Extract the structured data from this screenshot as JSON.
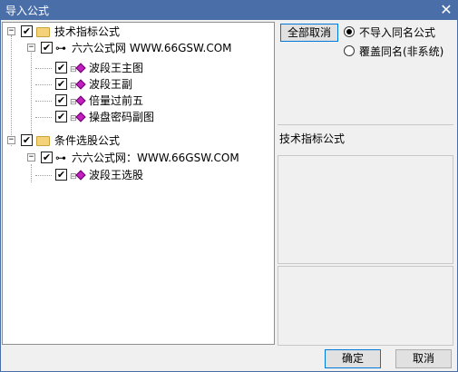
{
  "window": {
    "title": "导入公式",
    "close_glyph": "✕"
  },
  "tree": {
    "nodes": [
      {
        "label": "技术指标公式"
      },
      {
        "label": "六六公式网 WWW.66GSW.COM"
      },
      {
        "label": "波段王主图"
      },
      {
        "label": "波段王副"
      },
      {
        "label": "倍量过前五"
      },
      {
        "label": "操盘密码副图"
      },
      {
        "label": "条件选股公式"
      },
      {
        "label": "六六公式网：WWW.66GSW.COM"
      },
      {
        "label": "波段王选股"
      }
    ]
  },
  "options": {
    "deselect_all_label": "全部取消",
    "radio_skip_label": "不导入同名公式",
    "radio_overwrite_label": "覆盖同名(非系统)",
    "selected": "skip"
  },
  "info": {
    "category_label": "技术指标公式"
  },
  "footer": {
    "ok_label": "确定",
    "cancel_label": "取消"
  },
  "icons": {
    "check": "✔",
    "expand_minus": "−",
    "key": "⊶"
  }
}
